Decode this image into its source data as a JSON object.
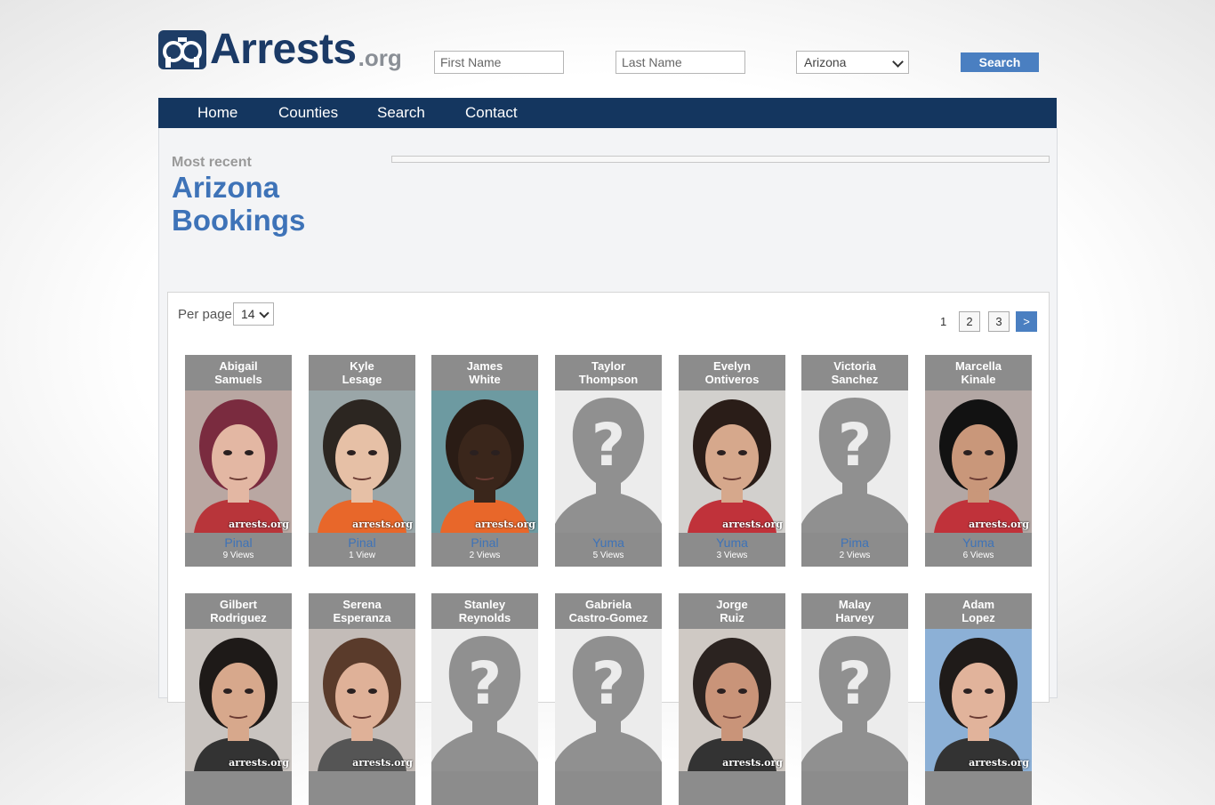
{
  "header": {
    "logo_text": "Arrests",
    "logo_suffix": ".org",
    "first_name_placeholder": "First Name",
    "last_name_placeholder": "Last Name",
    "state_selected": "Arizona",
    "search_label": "Search"
  },
  "nav": {
    "items": [
      {
        "label": "Home"
      },
      {
        "label": "Counties"
      },
      {
        "label": "Search"
      },
      {
        "label": "Contact"
      }
    ]
  },
  "intro": {
    "kicker": "Most recent",
    "title_line1": "Arizona",
    "title_line2": "Bookings"
  },
  "listing": {
    "per_page_label": "Per page",
    "per_page_value": "14",
    "pagination": {
      "current": "1",
      "pages": [
        "2",
        "3"
      ],
      "next": ">"
    },
    "watermark": "arrests.org",
    "cards": [
      {
        "first": "Abigail",
        "last": "Samuels",
        "county": "Pinal",
        "views": "9 Views",
        "photo": "photo-woman-red-hair"
      },
      {
        "first": "Kyle",
        "last": "Lesage",
        "county": "Pinal",
        "views": "1 View",
        "photo": "photo-man-curly-hair"
      },
      {
        "first": "James",
        "last": "White",
        "county": "Pinal",
        "views": "2 Views",
        "photo": "photo-man-bald"
      },
      {
        "first": "Taylor",
        "last": "Thompson",
        "county": "Yuma",
        "views": "5 Views",
        "photo": "placeholder-silhouette"
      },
      {
        "first": "Evelyn",
        "last": "Ontiveros",
        "county": "Yuma",
        "views": "3 Views",
        "photo": "photo-woman-dark-hair"
      },
      {
        "first": "Victoria",
        "last": "Sanchez",
        "county": "Pima",
        "views": "2 Views",
        "photo": "placeholder-silhouette"
      },
      {
        "first": "Marcella",
        "last": "Kinale",
        "county": "Yuma",
        "views": "6 Views",
        "photo": "photo-woman-black-hair"
      },
      {
        "first": "Gilbert",
        "last": "Rodriguez",
        "county": "",
        "views": "",
        "photo": "photo-man-short-hair"
      },
      {
        "first": "Serena",
        "last": "Esperanza",
        "county": "",
        "views": "",
        "photo": "photo-woman-brown-hair"
      },
      {
        "first": "Stanley",
        "last": "Reynolds",
        "county": "",
        "views": "",
        "photo": "placeholder-silhouette"
      },
      {
        "first": "Gabriela",
        "last": "Castro-Gomez",
        "county": "",
        "views": "",
        "photo": "placeholder-silhouette"
      },
      {
        "first": "Jorge",
        "last": "Ruiz",
        "county": "",
        "views": "",
        "photo": "photo-man-buzz-cut"
      },
      {
        "first": "Malay",
        "last": "Harvey",
        "county": "",
        "views": "",
        "photo": "placeholder-silhouette"
      },
      {
        "first": "Adam",
        "last": "Lopez",
        "county": "",
        "views": "",
        "photo": "photo-man-dark-hair"
      }
    ]
  }
}
